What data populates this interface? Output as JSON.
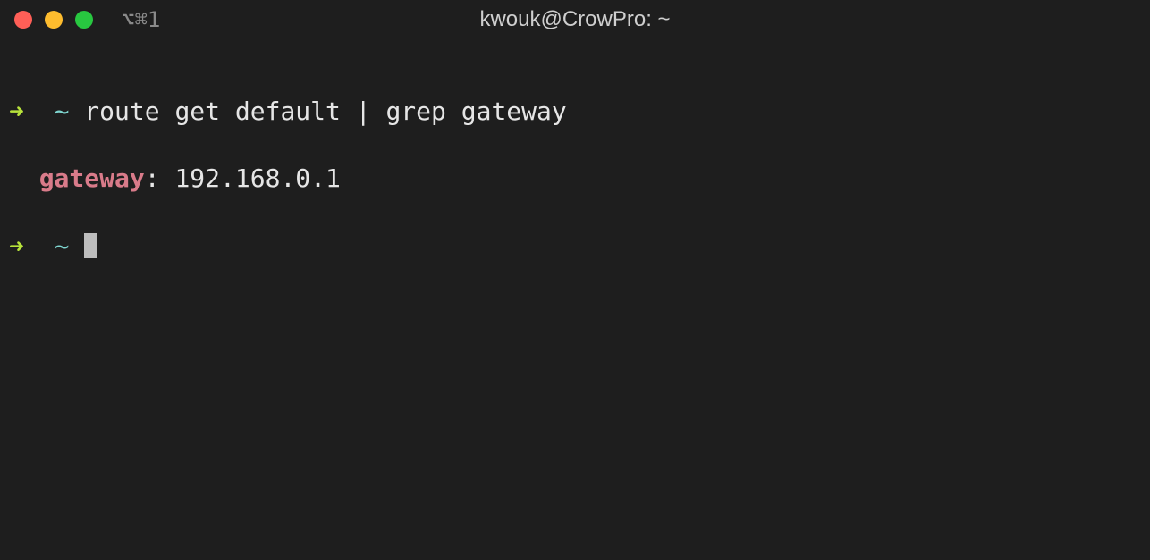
{
  "titlebar": {
    "shortcut": "⌥⌘1",
    "title": "kwouk@CrowPro: ~"
  },
  "prompt": {
    "arrow": "➜",
    "cwd": "~"
  },
  "session": {
    "command": "route get default | grep gateway",
    "output_key": "gateway",
    "output_sep": ": ",
    "output_value": "192.168.0.1"
  }
}
